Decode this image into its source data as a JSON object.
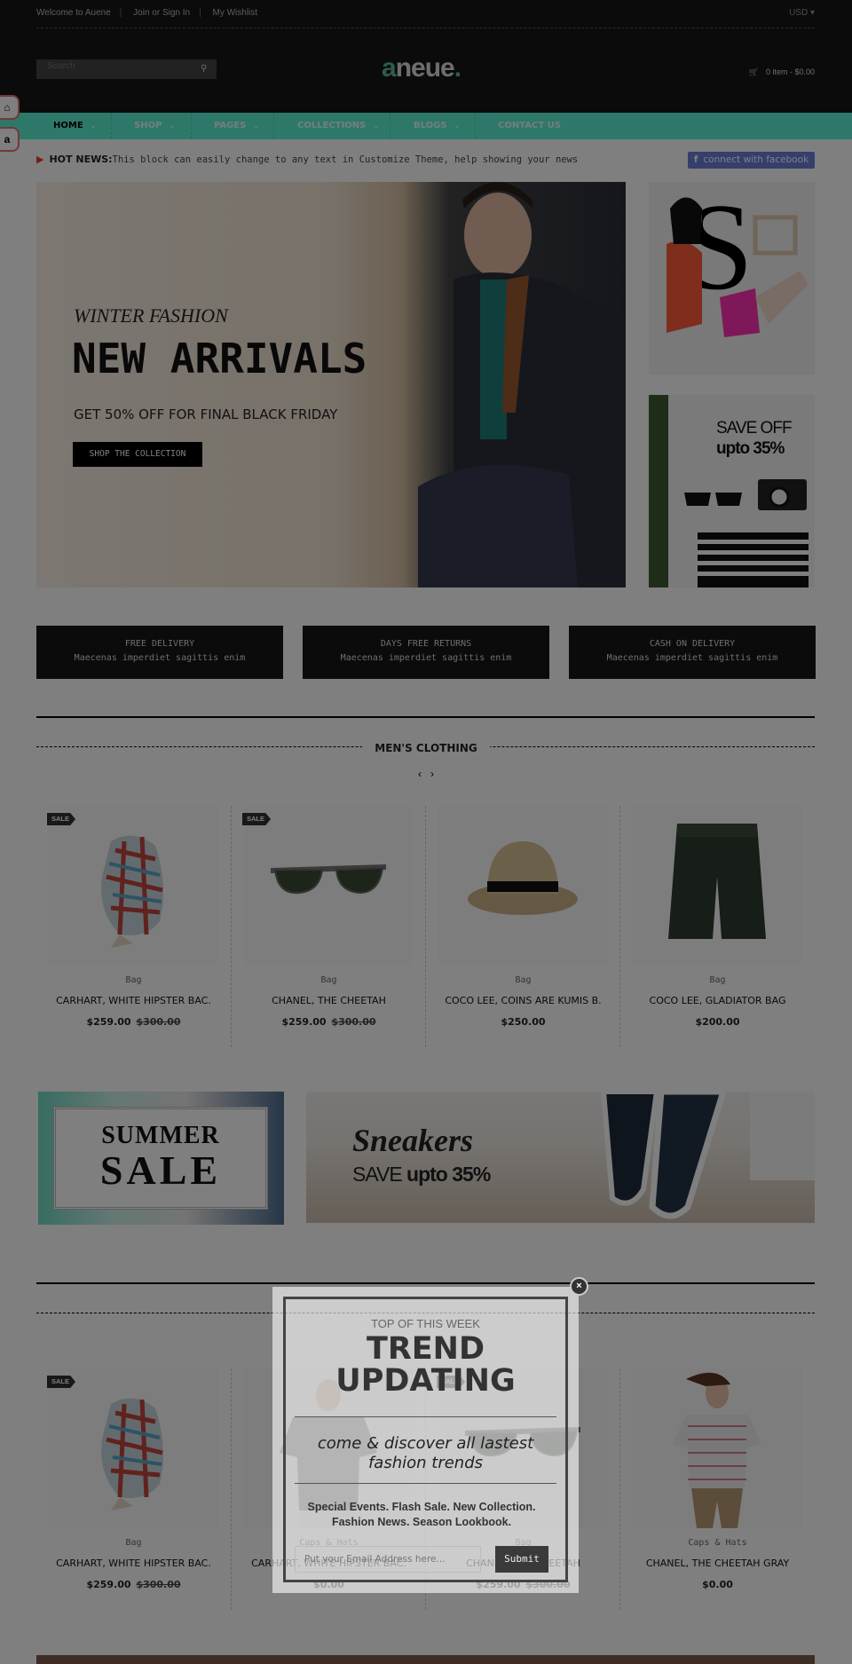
{
  "topbar": {
    "links": [
      "Welcome to Auene",
      "Join or Sign In",
      "My Wishlist"
    ],
    "currency": "USD"
  },
  "header": {
    "search_placeholder": "Search",
    "logo": {
      "accent": "a",
      "rest": "neue",
      "dot": "."
    },
    "cart": "0 item - $0.00"
  },
  "nav": {
    "items": [
      {
        "label": "HOME",
        "dropdown": true,
        "active": true
      },
      {
        "label": "SHOP",
        "dropdown": true
      },
      {
        "label": "PAGES",
        "dropdown": true
      },
      {
        "label": "COLLECTIONS",
        "dropdown": true
      },
      {
        "label": "BLOGS",
        "dropdown": true
      },
      {
        "label": "CONTACT US",
        "dropdown": false
      }
    ],
    "color": "#5cf0d4"
  },
  "side_buttons": [
    "home-icon",
    "a"
  ],
  "hotnews": {
    "title": "HOT NEWS:",
    "text": "This block can easily change to any text in Customize Theme, help showing your news"
  },
  "facebook": {
    "icon": "f",
    "label": "connect with facebook"
  },
  "hero": {
    "kicker": "WINTER FASHION",
    "title": "NEW ARRIVALS",
    "subtitle": "GET 50% OFF FOR FINAL BLACK FRIDAY",
    "button": "SHOP THE COLLECTION"
  },
  "side_banner2": {
    "line1": "SAVE OFF",
    "line2": "upto 35%"
  },
  "features": [
    {
      "title": "FREE DELIVERY",
      "text": "Maecenas imperdiet sagittis enim"
    },
    {
      "title": "DAYS FREE RETURNS",
      "text": "Maecenas imperdiet sagittis enim"
    },
    {
      "title": "CASH ON DELIVERY",
      "text": "Maecenas imperdiet sagittis enim"
    }
  ],
  "section1": {
    "title": "MEN'S CLOTHING",
    "prev": "‹",
    "next": "›",
    "products": [
      {
        "image": "scarf",
        "sale": "SALE",
        "category": "Bag",
        "name": "CARHART, WHITE HIPSTER BAC.",
        "price": "$259.00",
        "old_price": "$300.00"
      },
      {
        "image": "sunglasses",
        "sale": "SALE",
        "category": "Bag",
        "name": "CHANEL, THE CHEETAH",
        "price": "$259.00",
        "old_price": "$300.00"
      },
      {
        "image": "hat",
        "category": "Bag",
        "name": "COCO LEE, COINS ARE KUMIS B.",
        "price": "$250.00"
      },
      {
        "image": "shorts",
        "category": "Bag",
        "name": "COCO LEE, GLADIATOR BAG",
        "price": "$200.00"
      }
    ]
  },
  "promo": {
    "summer": {
      "line1": "SUMMER",
      "line2": "SALE"
    },
    "sneakers": {
      "title": "Sneakers",
      "save": "SAVE",
      "upto": "upto 35%"
    }
  },
  "section2": {
    "products": [
      {
        "image": "scarf",
        "sale": "SALE",
        "category": "Bag",
        "name": "CARHART, WHITE HIPSTER BAC.",
        "price": "$259.00",
        "old_price": "$300.00"
      },
      {
        "image": "tshirt-man",
        "category": "Caps & Hats",
        "name": "CARHART, WHITE HIPSTER BAC.",
        "price": "$0.00"
      },
      {
        "image": "sunglasses",
        "sale": "SALE",
        "category": "Bag",
        "name": "CHANEL, THE CHEETAH",
        "price": "$259.00",
        "old_price": "$300.00"
      },
      {
        "image": "striped-tee-man",
        "category": "Caps & Hats",
        "name": "CHANEL, THE CHEETAH GRAY",
        "price": "$0.00"
      }
    ]
  },
  "popup": {
    "kicker": "TOP OF THIS WEEK",
    "title_line1": "TREND",
    "title_line2": "UPDATING",
    "tagline_line1": "come & discover all lastest",
    "tagline_line2": "fashion trends",
    "text": "Special Events. Flash Sale. New Collection. Fashion News. Season Lookbook.",
    "email_placeholder": "Put your Email Address here...",
    "submit": "Submit",
    "close": "×"
  }
}
